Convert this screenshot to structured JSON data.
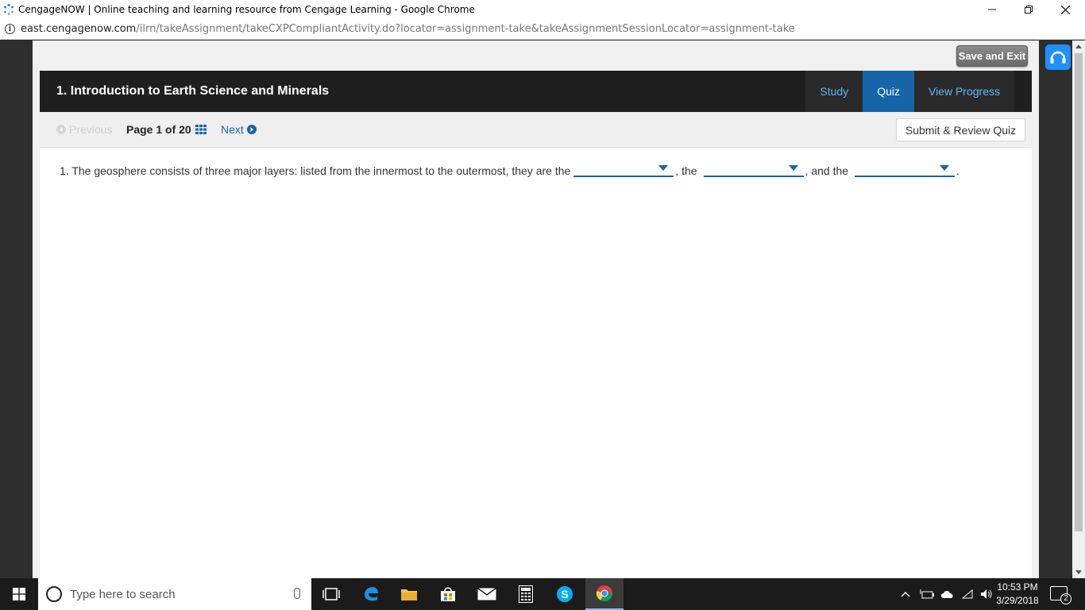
{
  "window": {
    "title": "CengageNOW | Online teaching and learning resource from Cengage Learning - Google Chrome"
  },
  "address": {
    "host": "east.cengagenow.com",
    "path": "/ilrn/takeAssignment/takeCXPCompliantActivity.do?locator=assignment-take&takeAssignmentSessionLocator=assignment-take"
  },
  "toolbar": {
    "save_exit_label": "Save and Exit"
  },
  "header": {
    "title": "1. Introduction to Earth Science and Minerals",
    "tabs": [
      {
        "label": "Study",
        "active": false
      },
      {
        "label": "Quiz",
        "active": true
      },
      {
        "label": "View Progress",
        "active": false
      }
    ]
  },
  "nav": {
    "previous_label": "Previous",
    "page_label": "Page 1 of 20",
    "next_label": "Next",
    "submit_label": "Submit & Review Quiz"
  },
  "question": {
    "text_start": "1. The geosphere consists of three major layers: listed from the innermost to the outermost, they are the",
    "sep1": ", the",
    "sep2": ", and the",
    "text_end": "."
  },
  "taskbar": {
    "search_placeholder": "Type here to search",
    "time": "10:53 PM",
    "date": "3/29/2018",
    "notification_count": "2"
  },
  "colors": {
    "accent": "#1565a8",
    "header_bg": "#1f1f1f",
    "tab_link": "#5db8ff"
  }
}
